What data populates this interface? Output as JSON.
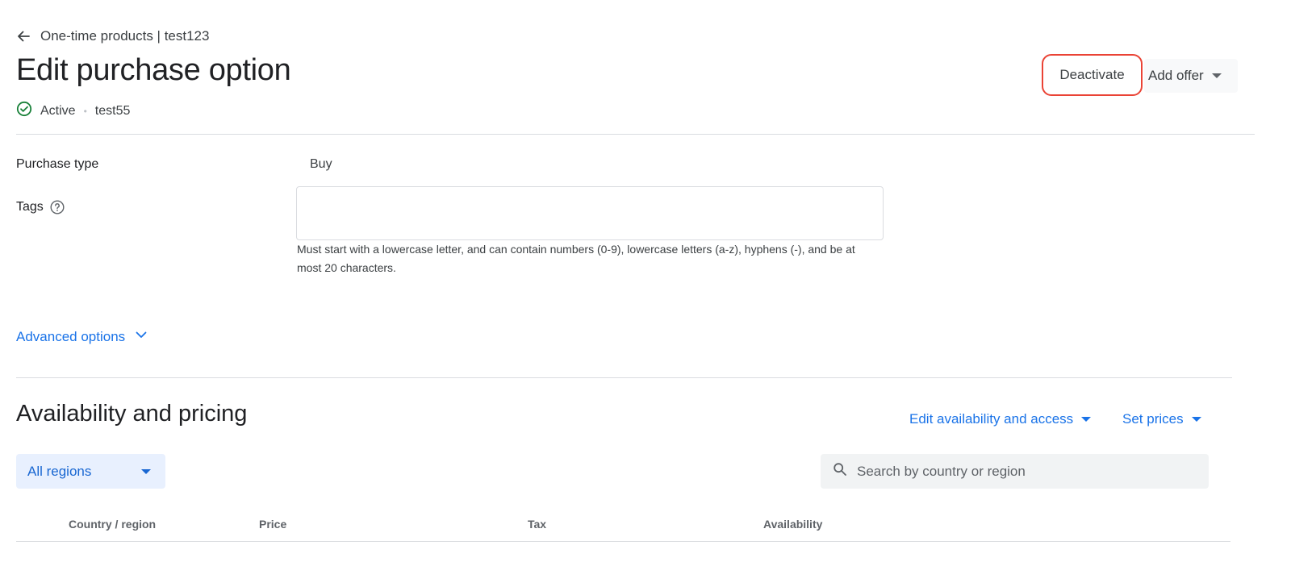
{
  "header": {
    "back_label": "One-time products | test123",
    "title": "Edit purchase option",
    "status": "Active",
    "status_separator": "•",
    "purchase_option_id": "test55",
    "deactivate_label": "Deactivate",
    "add_offer_label": "Add offer"
  },
  "form": {
    "purchase_type_label": "Purchase type",
    "purchase_type_value": "Buy",
    "tags_label": "Tags",
    "tags_value": "",
    "tags_help": "Must start with a lowercase letter, and can contain numbers (0-9), lowercase letters (a-z), hyphens (-), and be at most 20 characters.",
    "advanced_options_label": "Advanced options"
  },
  "availability": {
    "title": "Availability and pricing",
    "edit_availability_label": "Edit availability and access",
    "set_prices_label": "Set prices",
    "regions_selected": "All regions",
    "search_placeholder": "Search by country or region",
    "columns": [
      "Country / region",
      "Price",
      "Tax",
      "Availability"
    ]
  },
  "colors": {
    "accent": "#1a73e8",
    "status_green": "#188038",
    "highlight_red": "#ea4335"
  }
}
